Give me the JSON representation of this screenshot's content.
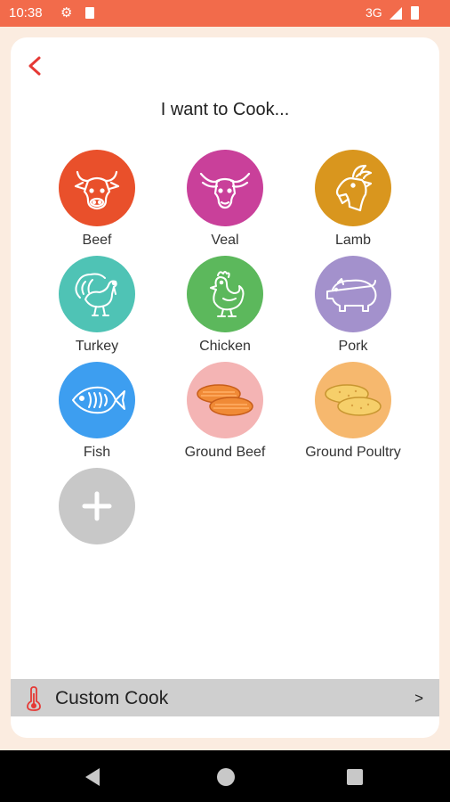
{
  "status_bar": {
    "time": "10:38",
    "network": "3G"
  },
  "screen": {
    "title": "I want to Cook..."
  },
  "items": [
    {
      "label": "Beef",
      "icon": "cow-head-icon",
      "color": "#e9502b"
    },
    {
      "label": "Veal",
      "icon": "calf-head-icon",
      "color": "#c9409a"
    },
    {
      "label": "Lamb",
      "icon": "goat-head-icon",
      "color": "#d9961e"
    },
    {
      "label": "Turkey",
      "icon": "turkey-icon",
      "color": "#4fc3b5"
    },
    {
      "label": "Chicken",
      "icon": "chicken-icon",
      "color": "#5cb85c"
    },
    {
      "label": "Pork",
      "icon": "pig-icon",
      "color": "#a391cc"
    },
    {
      "label": "Fish",
      "icon": "fish-icon",
      "color": "#3d9ef0"
    },
    {
      "label": "Ground Beef",
      "icon": "patties-icon",
      "color": "#f4b4b4"
    },
    {
      "label": "Ground Poultry",
      "icon": "patties-icon",
      "color": "#f6b86e"
    }
  ],
  "add_button": {
    "icon": "plus-icon",
    "color": "#c8c8c8"
  },
  "custom_cook": {
    "label": "Custom Cook",
    "arrow": ">",
    "icon": "thermometer-icon"
  },
  "colors": {
    "accent": "#f26b4b",
    "background": "#fbece0",
    "back_arrow": "#e53935"
  }
}
